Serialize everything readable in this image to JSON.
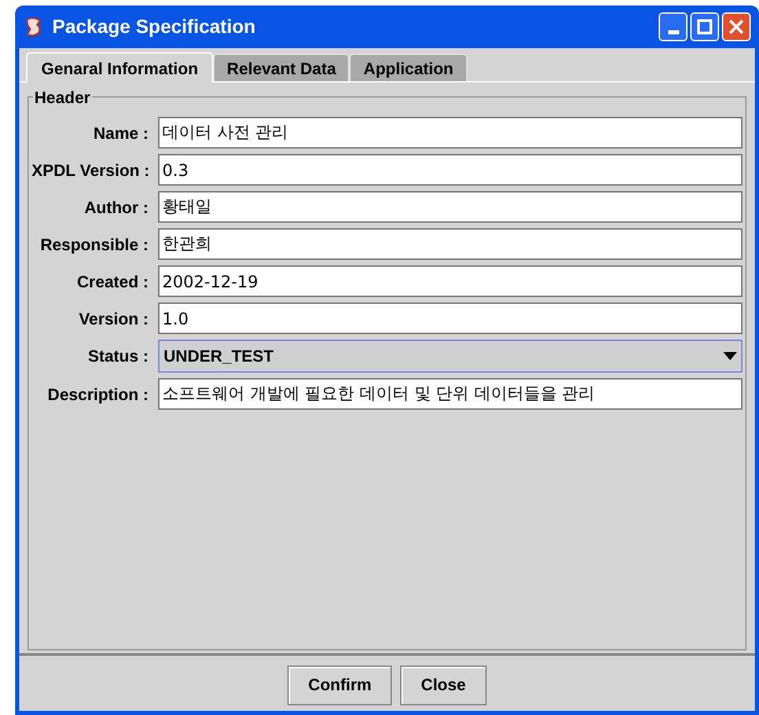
{
  "window": {
    "title": "Package Specification"
  },
  "tabs": [
    {
      "label": "Genaral Information",
      "selected": true
    },
    {
      "label": "Relevant Data",
      "selected": false
    },
    {
      "label": "Application",
      "selected": false
    }
  ],
  "group": {
    "title": "Header"
  },
  "fields": [
    {
      "label": "Name :",
      "kind": "text",
      "value": "데이터 사전 관리"
    },
    {
      "label": "XPDL Version :",
      "kind": "text",
      "value": "0.3"
    },
    {
      "label": "Author :",
      "kind": "text",
      "value": "황태일"
    },
    {
      "label": "Responsible :",
      "kind": "text",
      "value": "한관희"
    },
    {
      "label": "Created :",
      "kind": "text",
      "value": "2002-12-19"
    },
    {
      "label": "Version :",
      "kind": "text",
      "value": "1.0"
    },
    {
      "label": "Status :",
      "kind": "combo",
      "value": "UNDER_TEST"
    },
    {
      "label": "Description :",
      "kind": "text",
      "value": "소프트웨어 개발에 필요한 데이터 및 단위 데이터들을 관리"
    }
  ],
  "buttons": [
    "Confirm",
    "Close"
  ]
}
